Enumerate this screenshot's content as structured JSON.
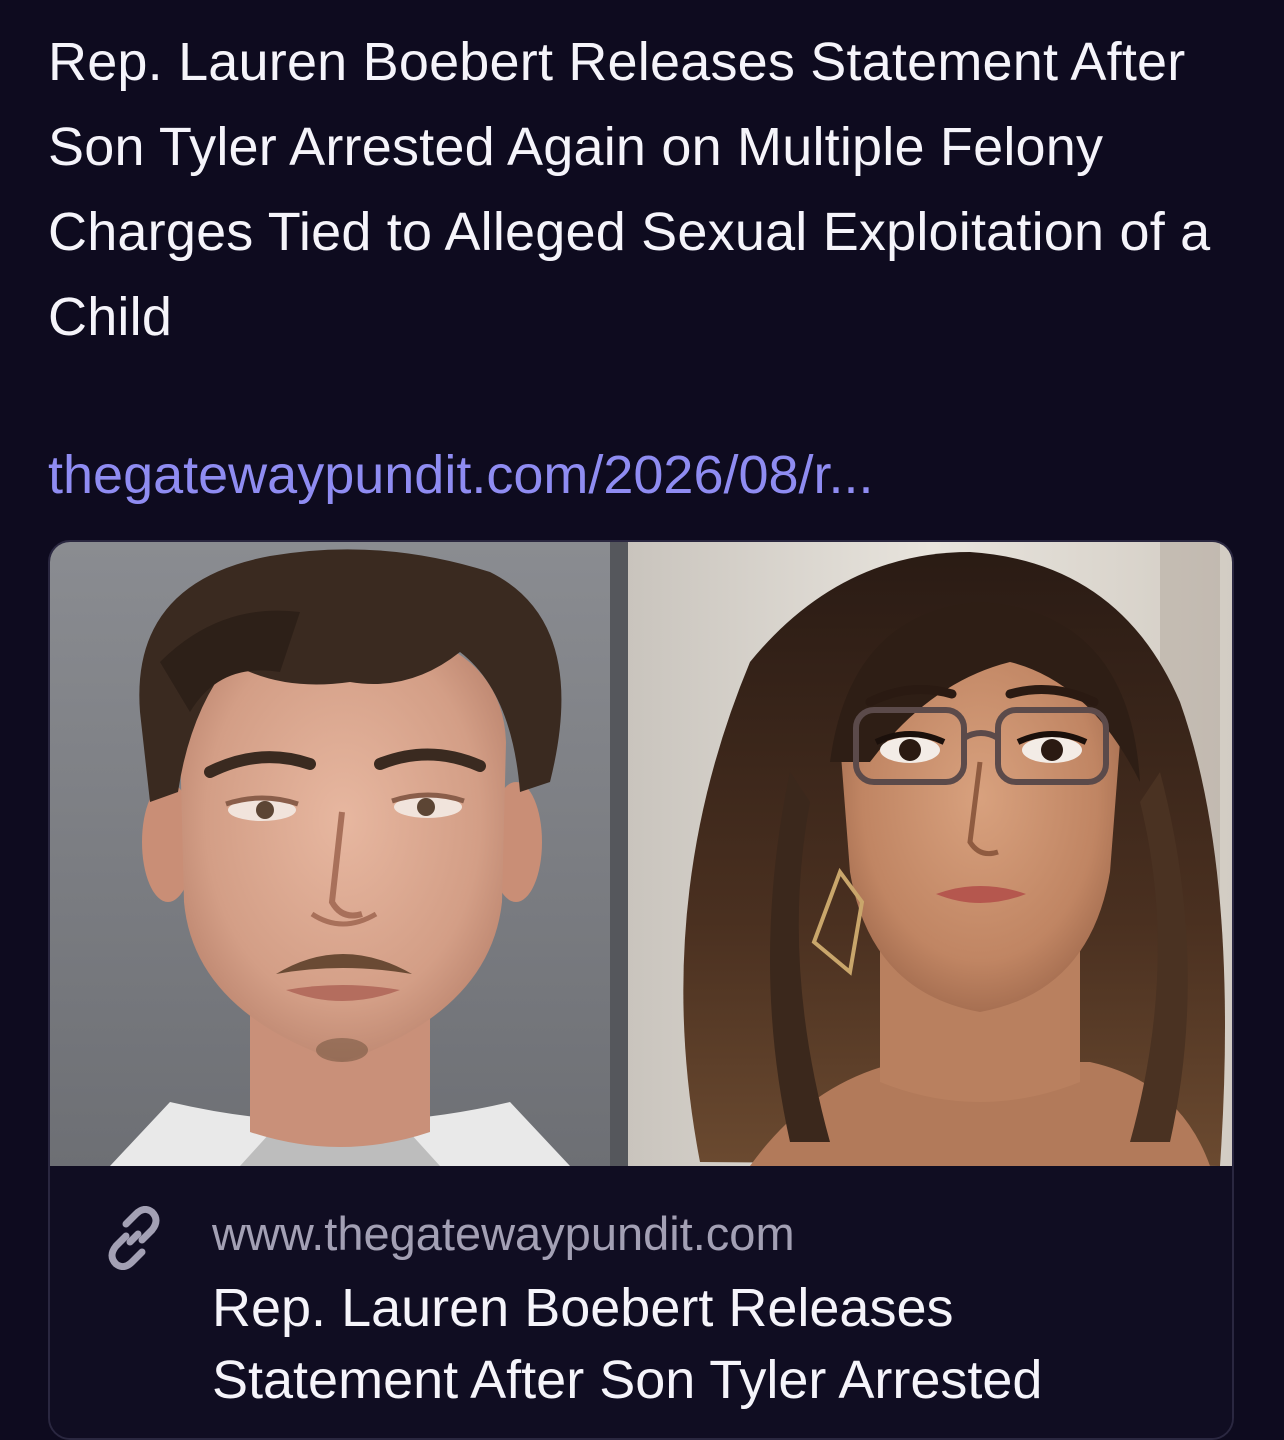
{
  "post": {
    "text": "Rep. Lauren Boebert Releases Statement After Son Tyler Arrested Again on Multiple Felony Charges Tied to Alleged Sexual Exploitation of a Child",
    "link_text": "thegatewaypundit.com/2026/08/r..."
  },
  "link_card": {
    "domain": "www.thegatewaypundit.com",
    "title": "Rep. Lauren Boebert Releases Statement After Son Tyler Arrested",
    "icon": "link-icon",
    "image": {
      "description_panels": [
        "young-man-mugshot",
        "woman-with-glasses-portrait"
      ]
    }
  },
  "colors": {
    "background": "#0e0b1f",
    "text": "#f5f4fa",
    "link": "#8f8cf2",
    "muted": "#a3a0b4",
    "card_border": "#2a2740"
  }
}
